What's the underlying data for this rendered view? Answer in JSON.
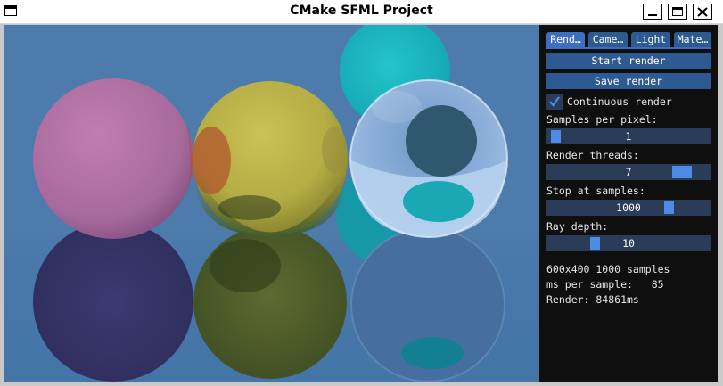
{
  "window": {
    "title": "CMake SFML Project"
  },
  "panel": {
    "tabs": [
      "Rend…",
      "Came…",
      "Light",
      "Mate…"
    ],
    "start_button": "Start render",
    "save_button": "Save render",
    "continuous_render": {
      "label": "Continuous render",
      "checked": true
    },
    "sliders": [
      {
        "label": "Samples per pixel:",
        "value": "1",
        "fraction": 0.02
      },
      {
        "label": "Render threads:",
        "value": "7",
        "fraction": 0.88
      },
      {
        "label": "Stop at samples:",
        "value": "1000",
        "fraction": 0.77
      },
      {
        "label": "Ray depth:",
        "value": "10",
        "fraction": 0.28
      }
    ],
    "stats": {
      "resolution_samples": "600x400 1000 samples",
      "ms_per_sample": "ms per sample:   85",
      "render_time": "Render: 84861ms"
    }
  },
  "colors": {
    "panel_bg": "#0f0f0f",
    "accent": "#2e5a93",
    "grab": "#4d8be4",
    "scene_bg": "#4b7bab"
  }
}
